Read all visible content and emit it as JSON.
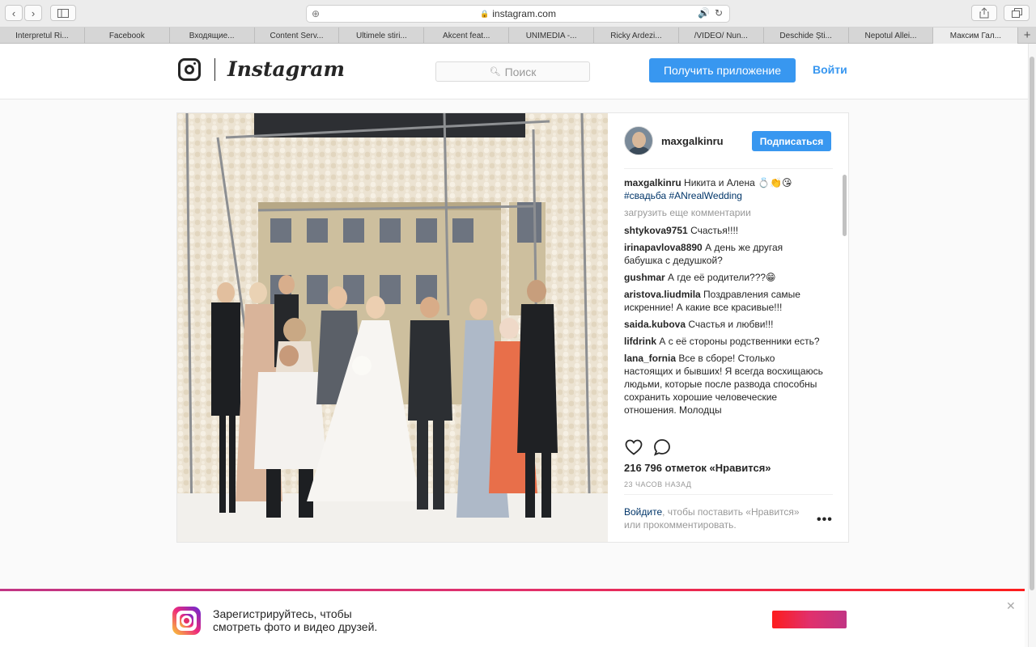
{
  "browser": {
    "url": "instagram.com",
    "tabs": [
      "Interpretul Ri...",
      "Facebook",
      "Входящие...",
      "Content Serv...",
      "Ultimele stiri...",
      "Akcent feat...",
      "UNIMEDIA -...",
      "Ricky Ardezi...",
      "/VIDEO/ Nun...",
      "Deschide Ști...",
      "Nepotul Allei...",
      "Максим Гал..."
    ],
    "new_tab_label": "+"
  },
  "header": {
    "wordmark": "Instagram",
    "search_placeholder": "Поиск",
    "get_app_label": "Получить приложение",
    "login_label": "Войти"
  },
  "post": {
    "username": "maxgalkinru",
    "follow_label": "Подписаться",
    "caption": {
      "user": "maxgalkinru",
      "text": "Никита и Алена 💍👏😘",
      "tags": "#свадьба #ANrealWedding"
    },
    "load_more_label": "загрузить еще комментарии",
    "comments": [
      {
        "user": "shtykova9751",
        "text": "Счастья!!!!"
      },
      {
        "user": "irinapavlova8890",
        "text": "А день же другая бабушка с дедушкой?"
      },
      {
        "user": "gushmar",
        "text": "А где её родители???😁"
      },
      {
        "user": "aristova.liudmila",
        "text": "Поздравления самые искренние! А какие все красивые!!!"
      },
      {
        "user": "saida.kubova",
        "text": "Счастья и любви!!!"
      },
      {
        "user": "lifdrink",
        "text": "А с её стороны родственники есть?"
      },
      {
        "user": "lana_fornia",
        "text": "Все в сборе! Столько настоящих и бывших! Я всегда восхищаюсь людьми, которые после развода способны сохранить хорошие человеческие отношения. Молодцы"
      }
    ],
    "likes": "216 796 отметок «Нравится»",
    "time": "23 ЧАСОВ НАЗАД",
    "login_prompt": {
      "link": "Войдите",
      "rest": ", чтобы поставить «Нравится» или прокомментировать."
    },
    "more_label": "•••"
  },
  "banner": {
    "line1": "Зарегистрируйтесь, чтобы",
    "line2": "смотреть фото и видео друзей.",
    "close_label": "✕"
  },
  "colors": {
    "accent": "#3897f0",
    "link_dark": "#003569",
    "muted": "#999999",
    "text": "#262626"
  }
}
